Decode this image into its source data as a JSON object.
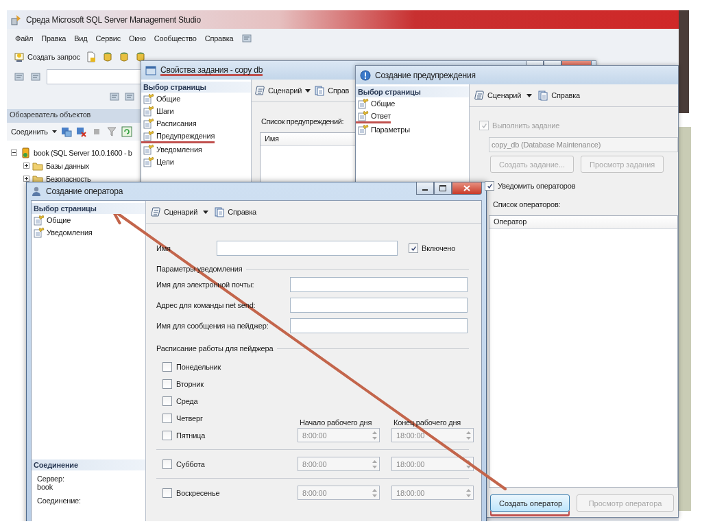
{
  "main_window": {
    "title": "Среда Microsoft SQL Server Management Studio",
    "menu": [
      "Файл",
      "Правка",
      "Вид",
      "Сервис",
      "Окно",
      "Сообщество",
      "Справка"
    ],
    "toolbar": {
      "new_query": "Создать запрос"
    },
    "object_explorer": {
      "title": "Обозреватель объектов",
      "connect": "Соединить",
      "tree": [
        {
          "label": "book (SQL Server 10.0.1600 - b",
          "kind": "server",
          "expanded": true,
          "children": [
            {
              "label": "Базы данных",
              "kind": "folder",
              "expanded": false
            },
            {
              "label": "Безопасность",
              "kind": "folder",
              "expanded": false
            }
          ]
        }
      ]
    }
  },
  "job_properties_window": {
    "title": "Свойства задания - copy db",
    "title_underlined": true,
    "page_selector": {
      "heading": "Выбор страницы",
      "items": [
        {
          "label": "Общие",
          "underlined": false
        },
        {
          "label": "Шаги",
          "underlined": false
        },
        {
          "label": "Расписания",
          "underlined": false
        },
        {
          "label": "Предупреждения",
          "underlined": true
        },
        {
          "label": "Уведомления",
          "underlined": false
        },
        {
          "label": "Цели",
          "underlined": false
        }
      ]
    },
    "toolbar": {
      "script": "Сценарий",
      "help": "Справ"
    },
    "alerts_label": "Список предупреждений:",
    "alerts_columns": [
      "Имя"
    ]
  },
  "alert_window": {
    "title": "Создание предупреждения",
    "page_selector": {
      "heading": "Выбор страницы",
      "items": [
        {
          "label": "Общие",
          "underlined": false
        },
        {
          "label": "Ответ",
          "underlined": true
        },
        {
          "label": "Параметры",
          "underlined": false
        }
      ]
    },
    "toolbar": {
      "script": "Сценарий",
      "help": "Справка"
    },
    "execute_job": {
      "label": "Выполнить задание",
      "checked": true,
      "disabled": true
    },
    "job_value": "copy_db (Database Maintenance)",
    "job_buttons": [
      {
        "label": "Создать задание...",
        "disabled": true
      },
      {
        "label": "Просмотр задания",
        "disabled": true
      }
    ],
    "notify_operators": {
      "label": "Уведомить операторов",
      "checked": true,
      "disabled": false
    },
    "operators_label": "Список операторов:",
    "operators_columns": [
      "Оператор"
    ],
    "buttons": [
      {
        "label": "Создать оператор",
        "disabled": false,
        "underlined": true
      },
      {
        "label": "Просмотр оператора",
        "disabled": true,
        "underlined": false
      }
    ]
  },
  "operator_window": {
    "title": "Создание оператора",
    "page_selector": {
      "heading": "Выбор страницы",
      "items": [
        {
          "label": "Общие",
          "underlined": false
        },
        {
          "label": "Уведомления",
          "underlined": false
        }
      ]
    },
    "connection": {
      "heading": "Соединение",
      "server_label": "Сервер:",
      "server": "book",
      "connection_label": "Соединение:"
    },
    "toolbar": {
      "script": "Сценарий",
      "help": "Справка"
    },
    "name_label": "Имя",
    "enabled": {
      "label": "Включено",
      "checked": true
    },
    "notification_group": "Параметры уведомления",
    "notification_fields": [
      "Имя для электронной почты:",
      "Адрес для команды net send:",
      "Имя для сообщения на пейджер:"
    ],
    "pager_group": "Расписание работы для пейджера",
    "start_label": "Начало рабочего дня",
    "end_label": "Конец рабочего дня",
    "day_groups": [
      {
        "days": [
          {
            "label": "Понедельник",
            "checked": false
          },
          {
            "label": "Вторник",
            "checked": false
          },
          {
            "label": "Среда",
            "checked": false
          },
          {
            "label": "Четверг",
            "checked": false
          },
          {
            "label": "Пятница",
            "checked": false
          }
        ],
        "start": "8:00:00",
        "end": "18:00:00",
        "disabled": true
      },
      {
        "days": [
          {
            "label": "Суббота",
            "checked": false
          }
        ],
        "start": "8:00:00",
        "end": "18:00:00",
        "disabled": true
      },
      {
        "days": [
          {
            "label": "Воскресенье",
            "checked": false
          }
        ],
        "start": "8:00:00",
        "end": "18:00:00",
        "disabled": true
      }
    ]
  },
  "annotation": {
    "kind": "arrow"
  }
}
